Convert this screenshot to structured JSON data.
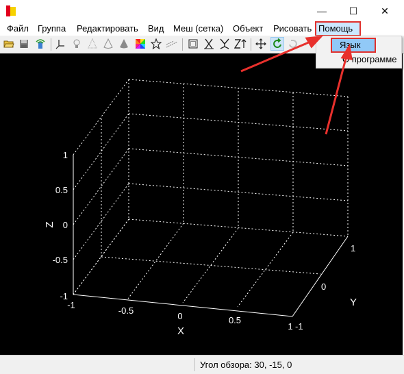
{
  "window": {
    "min_glyph": "—",
    "max_glyph": "☐",
    "close_glyph": "✕"
  },
  "menu": {
    "items": [
      "Файл",
      "Группа",
      "Редактировать",
      "Вид",
      "Меш (сетка)",
      "Объект",
      "Рисовать",
      "Помощь"
    ]
  },
  "help_menu": {
    "items": [
      "Язык",
      "О программе"
    ]
  },
  "toolbar": {
    "icons": [
      "open-icon",
      "save-icon",
      "export-icon",
      "axes-icon",
      "light-icon",
      "mesh-cone-icon",
      "cone-icon",
      "solid-cone-icon",
      "color-icon",
      "star-icon",
      "vector-icon",
      "box-icon",
      "axes-x-icon",
      "axes-y-icon",
      "z-sort-icon",
      "move-icon",
      "rotate-icon",
      "redo-icon",
      "pan-icon"
    ]
  },
  "plot": {
    "z_label": "Z",
    "x_label": "X",
    "y_label": "Y",
    "z_ticks": [
      "1",
      "0.5",
      "0",
      "-0.5",
      "-1"
    ],
    "x_ticks": [
      "-1",
      "-0.5",
      "0",
      "0.5",
      "1"
    ],
    "y_ticks": [
      "-1",
      "0",
      "1"
    ]
  },
  "status": {
    "view_angle": "Угол обзора: 30, -15, 0"
  },
  "colors": {
    "highlight_outline": "#e0302c",
    "menu_active_bg": "#cce8ff",
    "dropdown_highlight_bg": "#91c9f7",
    "canvas_bg": "#000000",
    "grid": "#ffffff"
  }
}
